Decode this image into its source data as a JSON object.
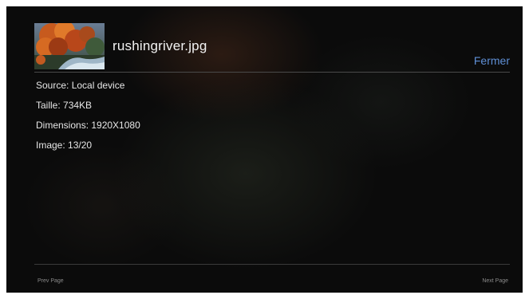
{
  "header": {
    "filename": "rushingriver.jpg",
    "close_label": "Fermer"
  },
  "info": {
    "source": "Source: Local device",
    "size": "Taille: 734KB",
    "dimensions": "Dimensions: 1920X1080",
    "image_index": "Image: 13/20"
  },
  "footer": {
    "prev_label": "Prev Page",
    "next_label": "Next Page"
  },
  "colors": {
    "accent": "#5f8fd6",
    "text": "#e6e6e6",
    "background": "#0b0b0b"
  }
}
